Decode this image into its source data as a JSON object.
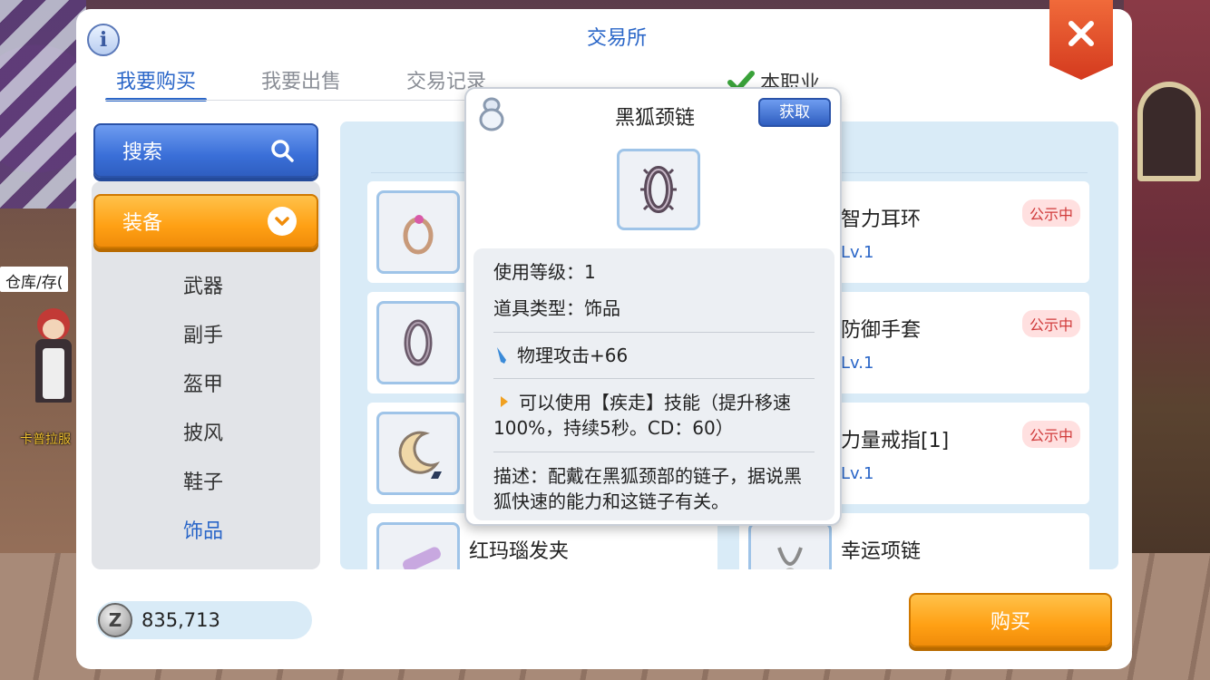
{
  "dialog": {
    "title": "交易所",
    "tabs": [
      {
        "label": "我要购买",
        "active": true
      },
      {
        "label": "我要出售",
        "active": false
      },
      {
        "label": "交易记录",
        "active": false
      }
    ],
    "job_filter": {
      "label": "本职业",
      "checked": true
    }
  },
  "sidebar": {
    "search_label": "搜索",
    "category_label": "装备",
    "items": [
      {
        "label": "武器"
      },
      {
        "label": "副手"
      },
      {
        "label": "盔甲"
      },
      {
        "label": "披风"
      },
      {
        "label": "鞋子"
      },
      {
        "label": "饰品",
        "active": true
      }
    ]
  },
  "listings": [
    {
      "name": "",
      "level": "",
      "badge": "",
      "icon": "ring-icon"
    },
    {
      "name": "智力耳环",
      "level": "Lv.1",
      "badge": "公示中",
      "icon": "earring-icon"
    },
    {
      "name": "",
      "level": "",
      "badge": "",
      "icon": "collar-icon"
    },
    {
      "name": "防御手套",
      "level": "Lv.1",
      "badge": "公示中",
      "icon": "glove-icon"
    },
    {
      "name": "",
      "level": "",
      "badge": "",
      "icon": "moon-icon"
    },
    {
      "name": "力量戒指[1]",
      "level": "Lv.1",
      "badge": "公示中",
      "icon": "ring-icon"
    },
    {
      "name": "红玛瑙发夹",
      "level": "",
      "badge": "",
      "icon": "hairpin-icon"
    },
    {
      "name": "幸运项链",
      "level": "",
      "badge": "",
      "icon": "necklace-icon"
    }
  ],
  "tooltip": {
    "title": "黑狐颈链",
    "obtain_label": "获取",
    "use_level": "使用等级：1",
    "item_type": "道具类型：饰品",
    "attack": "物理攻击+66",
    "skill": "可以使用【疾走】技能（提升移速100%，持续5秒。CD：60）",
    "description": "描述：配戴在黑狐颈部的链子，据说黑狐快速的能力和这链子有关。"
  },
  "footer": {
    "zeny": "835,713",
    "buy_label": "购买"
  },
  "scene": {
    "npc_tag": "仓库/存(",
    "npc_name": "卡普拉服"
  },
  "colors": {
    "accent_blue": "#2a66c8",
    "button_orange": "#ffa014",
    "badge_red": "#d03a3a",
    "close_red": "#e04a2a"
  }
}
